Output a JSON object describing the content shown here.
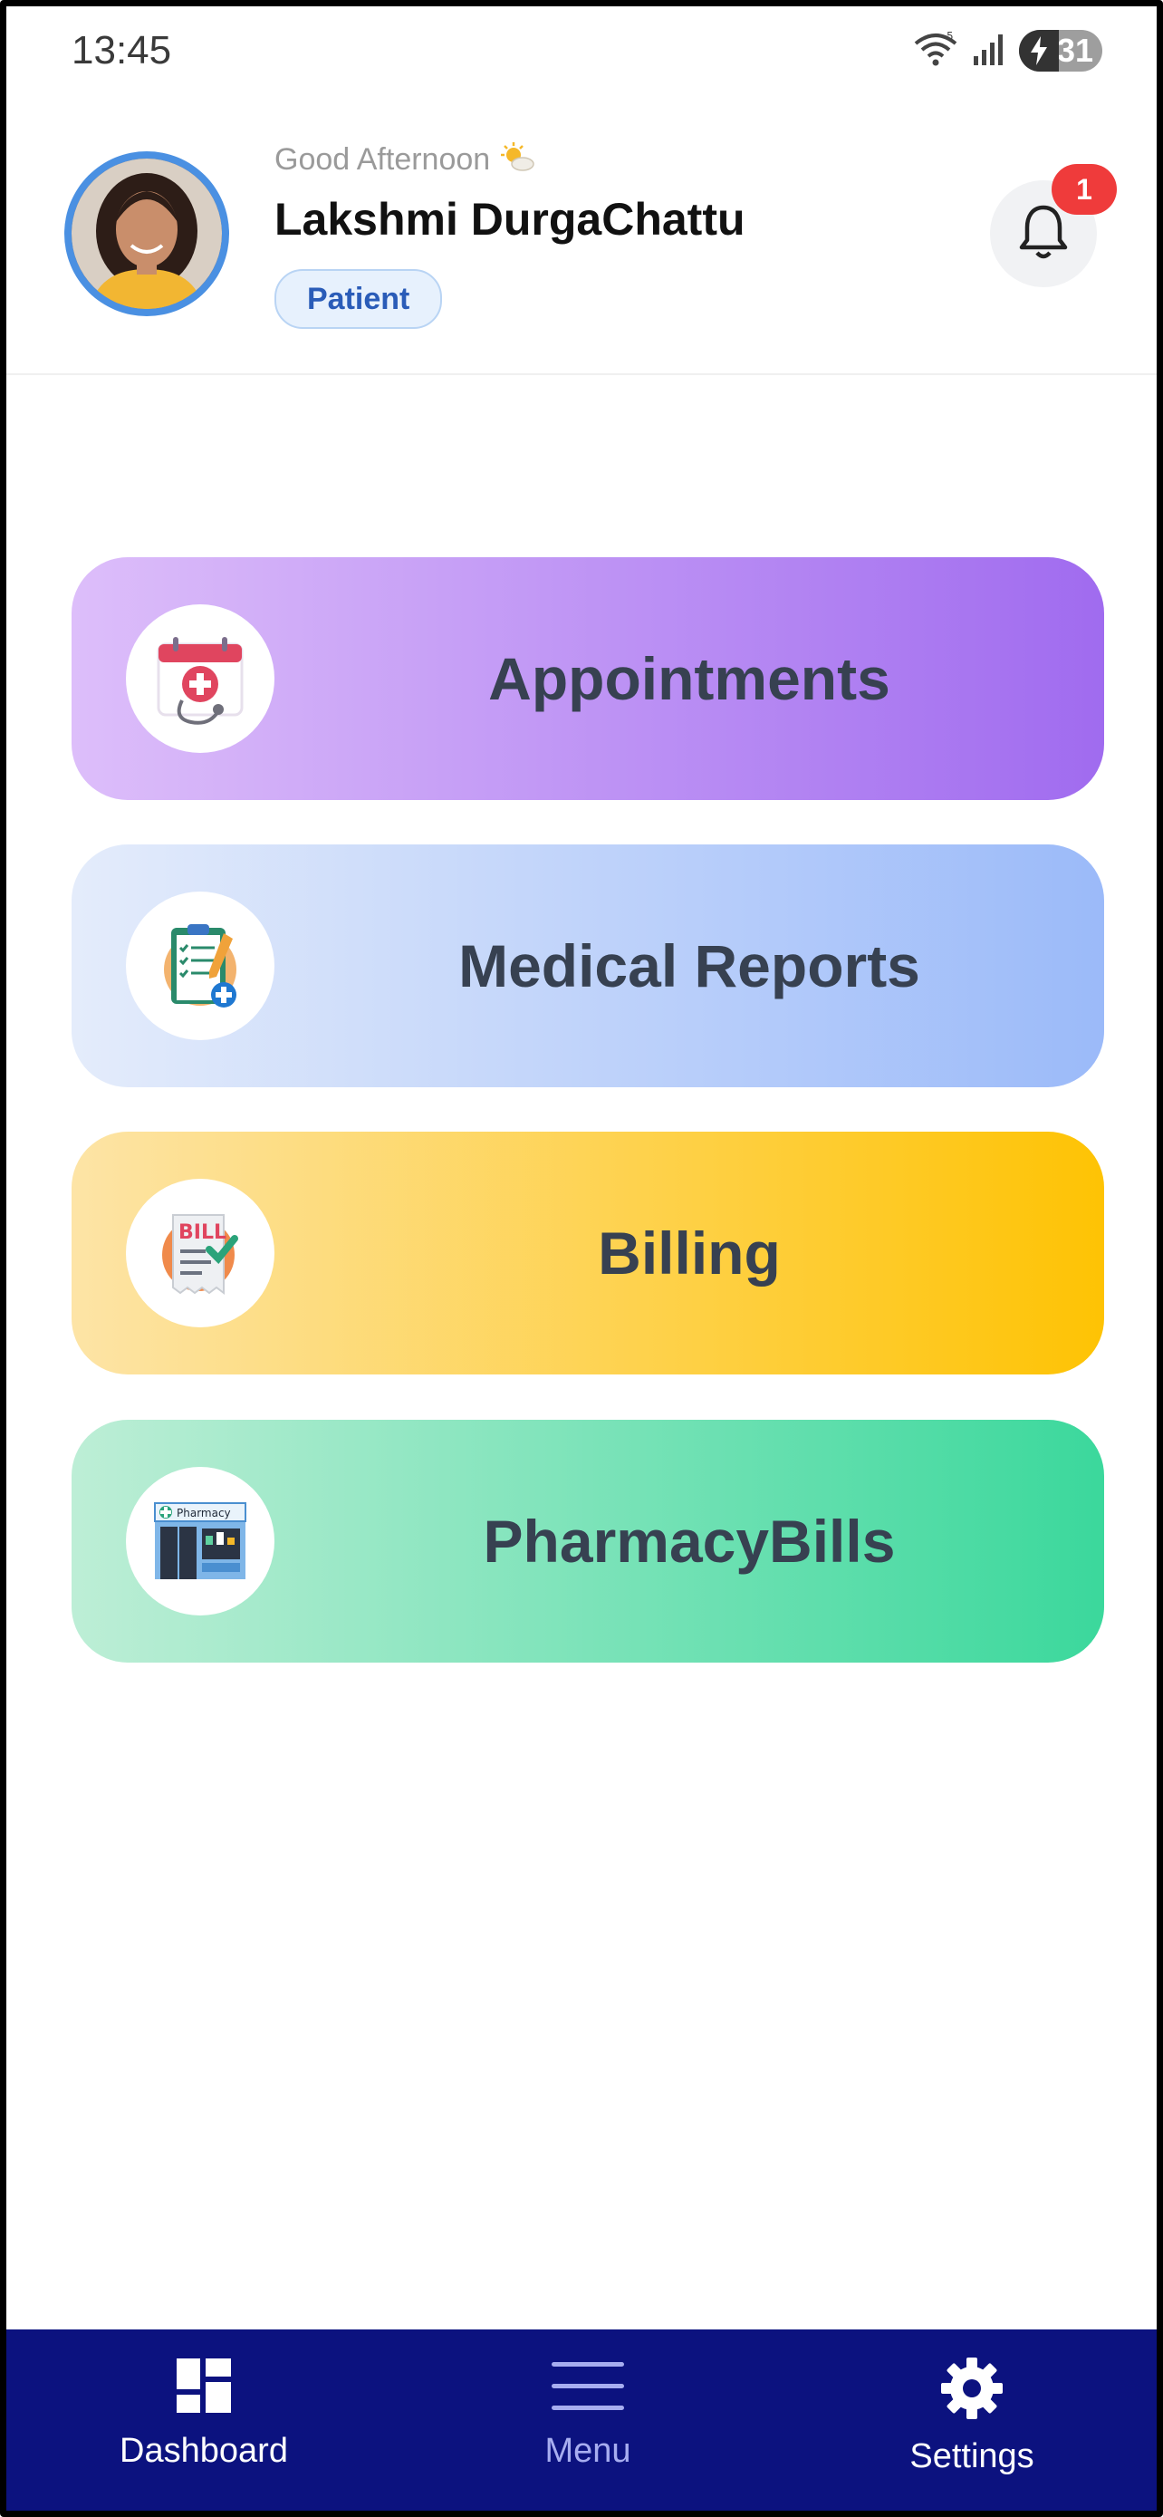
{
  "status_bar": {
    "time": "13:45",
    "wifi_icon": "wifi-icon",
    "signal_icon": "signal-icon",
    "battery_level": "31",
    "colors": {
      "battery": "#9e9e9e"
    }
  },
  "header": {
    "greeting": "Good Afternoon",
    "greeting_icon": "sun-cloud-icon",
    "user_name": "Lakshmi DurgaChattu",
    "role": "Patient",
    "notification_count": "1"
  },
  "cards": [
    {
      "label": "Appointments",
      "icon": "calendar-stethoscope-icon"
    },
    {
      "label": "Medical Reports",
      "icon": "clipboard-report-icon"
    },
    {
      "label": "Billing",
      "icon": "bill-icon"
    },
    {
      "label": "PharmacyBills",
      "icon": "pharmacy-store-icon"
    }
  ],
  "bottom_nav": {
    "items": [
      {
        "label": "Dashboard",
        "icon": "dashboard-icon"
      },
      {
        "label": "Menu",
        "icon": "menu-icon"
      },
      {
        "label": "Settings",
        "icon": "gear-icon"
      }
    ],
    "colors": {
      "background": "#0c127f",
      "active_text": "#ffffff",
      "inactive_text": "#a7adf0"
    }
  }
}
